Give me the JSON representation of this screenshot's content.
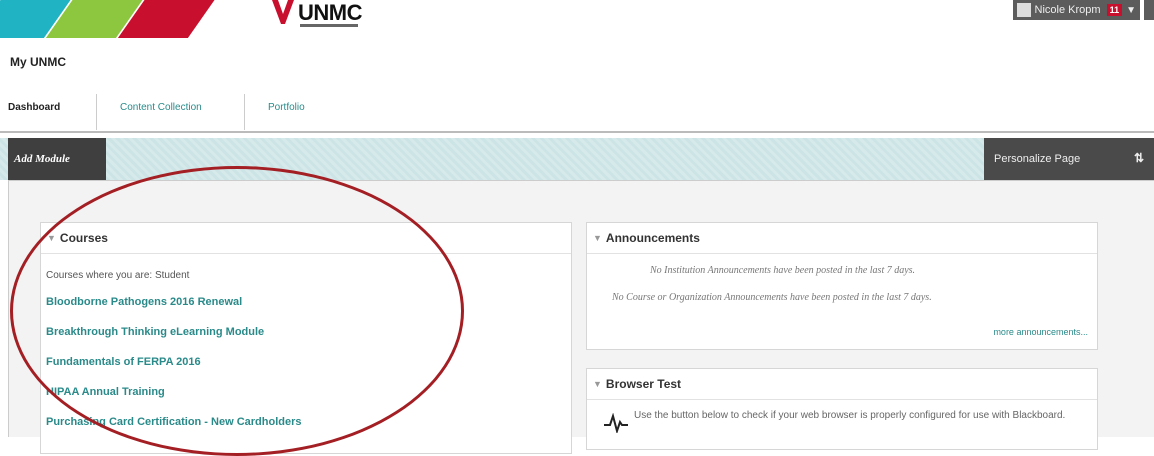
{
  "header": {
    "brand": "UNMC",
    "stripe_colors": [
      "#1fb3c4",
      "#8dc63f",
      "#c8102e"
    ],
    "user": {
      "name": "Nicole Kropm",
      "notification_count": "11",
      "menu_icon": "chevron-down-icon"
    }
  },
  "site_title": "My UNMC",
  "tabs": [
    {
      "label": "Dashboard"
    },
    {
      "label": "Content Collection"
    },
    {
      "label": "Portfolio"
    }
  ],
  "actionbar": {
    "add_module": "Add Module",
    "personalize": "Personalize Page",
    "sort_icon": "sort-icon",
    "sort_glyph": "⇅"
  },
  "courses": {
    "title": "Courses",
    "subtitle": "Courses where you are: Student",
    "items": [
      "Bloodborne Pathogens 2016 Renewal",
      "Breakthrough Thinking eLearning Module",
      "Fundamentals of FERPA 2016",
      "HIPAA Annual Training",
      "Purchasing Card Certification - New Cardholders"
    ]
  },
  "announcements": {
    "title": "Announcements",
    "institution_msg": "No Institution Announcements have been posted in the last 7 days.",
    "course_msg": "No Course or Organization Announcements have been posted in the last 7 days.",
    "more_link": "more announcements..."
  },
  "browser_test": {
    "title": "Browser Test",
    "text": "Use the button below to check if your web browser is properly configured for use with Blackboard."
  },
  "colors": {
    "accent": "#2a8a8a",
    "annotation_circle": "#a31f24"
  }
}
